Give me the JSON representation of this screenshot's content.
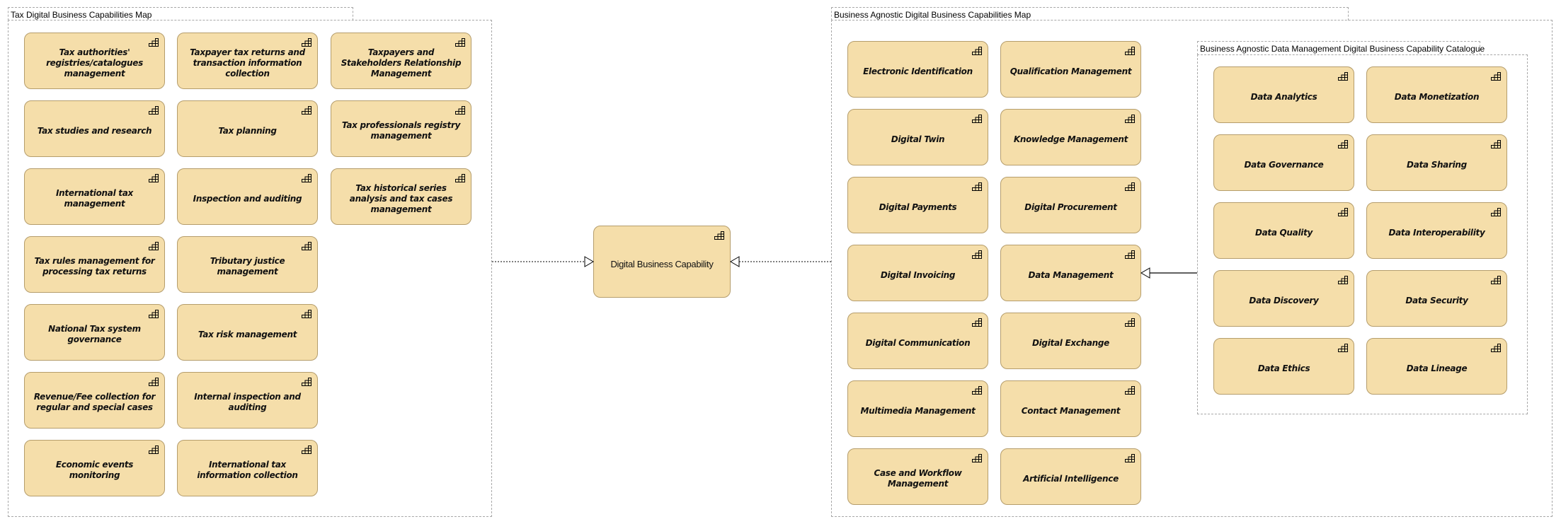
{
  "colors": {
    "capability_fill": "#f5deaa",
    "capability_border": "#b59d6c",
    "frame_border": "#a8a8a8"
  },
  "tax_map": {
    "title": "Tax Digital Business Capabilities Map",
    "columns": [
      [
        "Tax authorities' registries/catalogues management",
        "Tax studies and research",
        "International tax management",
        "Tax rules management for processing tax returns",
        "National Tax system governance",
        "Revenue/Fee collection for regular and special cases",
        "Economic events monitoring"
      ],
      [
        "Taxpayer tax returns and transaction information collection",
        "Tax planning",
        "Inspection and auditing",
        "Tributary justice management",
        "Tax risk management",
        "Internal inspection and auditing",
        "International tax information collection"
      ],
      [
        "Taxpayers and Stakeholders Relationship Management",
        "Tax professionals registry management",
        "Tax historical series analysis and tax cases management"
      ]
    ]
  },
  "center": {
    "label": "Digital Business Capability"
  },
  "agnostic_map": {
    "title": "Business Agnostic Digital Business Capabilities Map",
    "columns": [
      [
        "Electronic Identification",
        "Digital Twin",
        "Digital Payments",
        "Digital Invoicing",
        "Digital Communication",
        "Multimedia Management",
        "Case and Workflow Management"
      ],
      [
        "Qualification Management",
        "Knowledge Management",
        "Digital Procurement",
        "Data Management",
        "Digital Exchange",
        "Contact Management",
        "Artificial Intelligence"
      ]
    ]
  },
  "data_catalogue": {
    "title": "Business Agnostic Data Management Digital Business Capability Catalogue",
    "columns": [
      [
        "Data Analytics",
        "Data Governance",
        "Data Quality",
        "Data Discovery",
        "Data Ethics"
      ],
      [
        "Data Monetization",
        "Data Sharing",
        "Data Interoperability",
        "Data Security",
        "Data Lineage"
      ]
    ]
  },
  "relations": [
    {
      "from": "Tax Digital Business Capabilities Map",
      "to": "Digital Business Capability",
      "type": "specialization-dotted"
    },
    {
      "from": "Business Agnostic Digital Business Capabilities Map",
      "to": "Digital Business Capability",
      "type": "specialization-dotted"
    },
    {
      "from": "Business Agnostic Data Management Digital Business Capability Catalogue",
      "to": "Data Management",
      "type": "specialization"
    }
  ],
  "icons": {
    "capability": "capability-icon"
  }
}
